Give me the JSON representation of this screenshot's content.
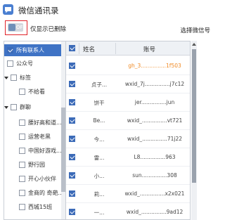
{
  "window": {
    "title": "微信通讯录"
  },
  "toolbar": {
    "toggle_text": "OFF",
    "toggle_label": "仅显示已删除",
    "sync_label": "选择微信号"
  },
  "groups": [
    {
      "label": "所有联系人",
      "checked": true,
      "selected": true
    },
    {
      "label": "公众号",
      "checked": false
    },
    {
      "label": "标签",
      "checked": false,
      "expandable": true
    },
    {
      "label": "不给看",
      "checked": false
    },
    {
      "label": "群聊",
      "checked": false,
      "expandable": true
    },
    {
      "label": "腰好高和道...",
      "checked": false
    },
    {
      "label": "运营老黑",
      "checked": false
    },
    {
      "label": "中国好游戏...",
      "checked": false
    },
    {
      "label": "野行园",
      "checked": false
    },
    {
      "label": "开心小伙伴",
      "checked": false
    },
    {
      "label": "金商的 奇葩...",
      "checked": false
    },
    {
      "label": "西城15班",
      "checked": false
    }
  ],
  "table": {
    "headers": {
      "name": "姓名",
      "account": "账号"
    },
    "rows": [
      {
        "name": "",
        "account": "gh_3...............1f503",
        "highlight": true
      },
      {
        "name": "贞子...",
        "account": "wxid_7j...............j7c12"
      },
      {
        "name": "饼干",
        "account": "jer...............jun"
      },
      {
        "name": "Be...",
        "account": "wxid_...............vt721"
      },
      {
        "name": "今...",
        "account": "wxid_...............71j22"
      },
      {
        "name": "雷...",
        "account": "L8...............963"
      },
      {
        "name": "小...",
        "account": "sun...............308"
      },
      {
        "name": "莉...",
        "account": "wxid_...............x2x021"
      },
      {
        "name": "一...",
        "account": "wxid_...............9ad12"
      }
    ]
  }
}
